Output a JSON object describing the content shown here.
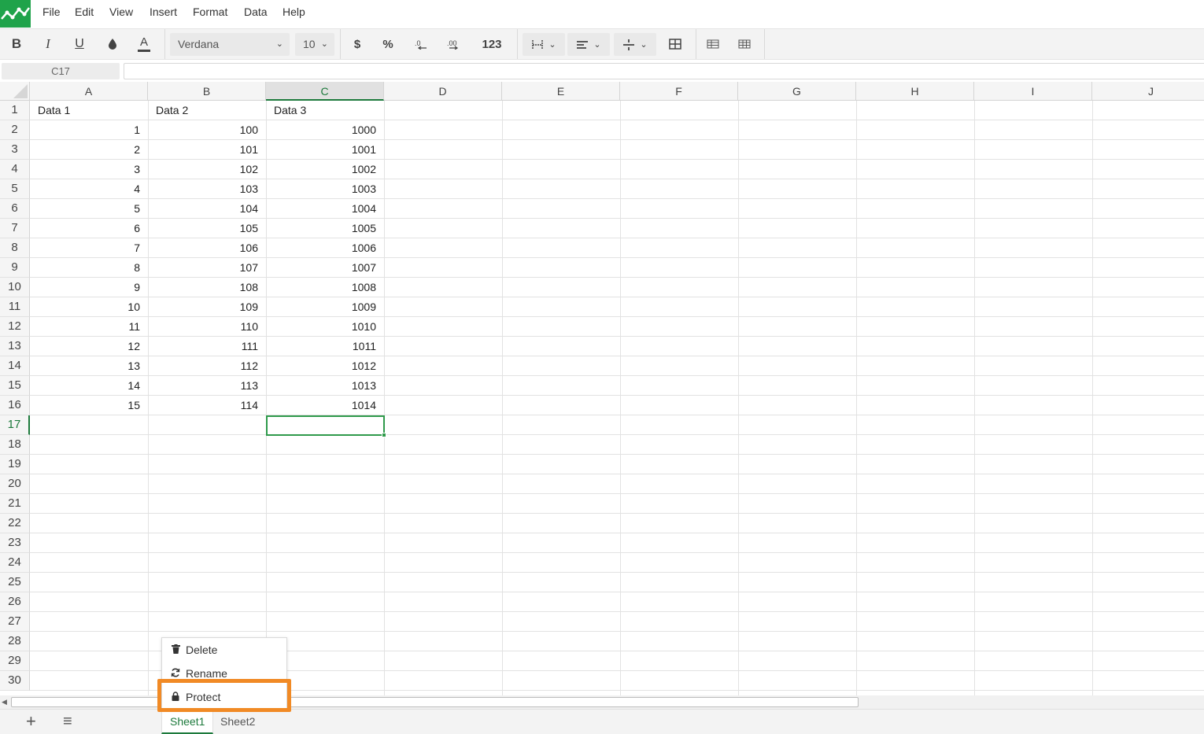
{
  "menu": [
    "File",
    "Edit",
    "View",
    "Insert",
    "Format",
    "Data",
    "Help"
  ],
  "toolbar": {
    "font_family": "Verdana",
    "font_size": "10",
    "currency_label": "$",
    "percent_label": "%",
    "number_format_label": "123"
  },
  "formula_bar": {
    "cell_ref": "C17",
    "value": ""
  },
  "columns": [
    "A",
    "B",
    "C",
    "D",
    "E",
    "F",
    "G",
    "H",
    "I",
    "J"
  ],
  "active_column": "C",
  "active_row": 17,
  "rows": [
    1,
    2,
    3,
    4,
    5,
    6,
    7,
    8,
    9,
    10,
    11,
    12,
    13,
    14,
    15,
    16,
    17,
    18,
    19,
    20,
    21,
    22,
    23,
    24,
    25,
    26,
    27,
    28,
    29,
    30
  ],
  "cells": {
    "header": [
      "Data 1",
      "Data 2",
      "Data 3"
    ],
    "data": [
      [
        1,
        100,
        1000
      ],
      [
        2,
        101,
        1001
      ],
      [
        3,
        102,
        1002
      ],
      [
        4,
        103,
        1003
      ],
      [
        5,
        104,
        1004
      ],
      [
        6,
        105,
        1005
      ],
      [
        7,
        106,
        1006
      ],
      [
        8,
        107,
        1007
      ],
      [
        9,
        108,
        1008
      ],
      [
        10,
        109,
        1009
      ],
      [
        11,
        110,
        1010
      ],
      [
        12,
        111,
        1011
      ],
      [
        13,
        112,
        1012
      ],
      [
        14,
        113,
        1013
      ],
      [
        15,
        114,
        1014
      ]
    ]
  },
  "context_menu": {
    "items": [
      {
        "label": "Delete",
        "icon": "trash-icon"
      },
      {
        "label": "Rename",
        "icon": "refresh-icon"
      },
      {
        "label": "Protect",
        "icon": "lock-icon"
      }
    ],
    "highlighted": "Protect"
  },
  "sheets": [
    "Sheet1",
    "Sheet2"
  ],
  "active_sheet": "Sheet1",
  "colors": {
    "accent_green": "#1d7a3c",
    "logo_green": "#1fa34a",
    "highlight_orange": "#f18a25"
  }
}
